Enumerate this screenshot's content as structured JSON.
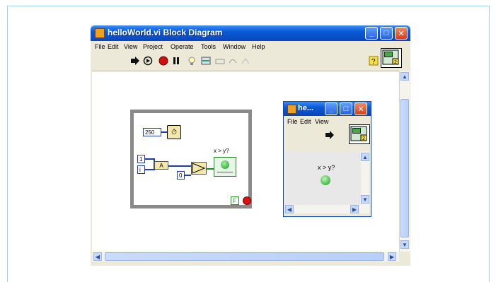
{
  "main_window": {
    "title": "helloWorld.vi Block Diagram",
    "menu": [
      "File",
      "Edit",
      "View",
      "Project",
      "Operate",
      "Tools",
      "Window",
      "Help"
    ],
    "diagram": {
      "wait_constant": "250",
      "const_top": "1",
      "const_i": "i",
      "add_symbol": "A",
      "zero_constant": "0",
      "indicator_label": "x > y?",
      "stop_constant": "F"
    }
  },
  "front_panel": {
    "title": "he...",
    "menu": [
      "File",
      "Edit",
      "View"
    ],
    "indicator_label": "x > y?"
  },
  "colors": {
    "titlebar": "#0a58d8",
    "close_button": "#d5401a",
    "wire_blue": "#2040a0",
    "boolean_green": "#1a9a1a",
    "loop_gray": "#8a8a8a"
  },
  "icons": [
    "run-arrow-icon",
    "run-continuously-icon",
    "abort-icon",
    "pause-icon",
    "highlight-execution-icon",
    "help-icon"
  ]
}
